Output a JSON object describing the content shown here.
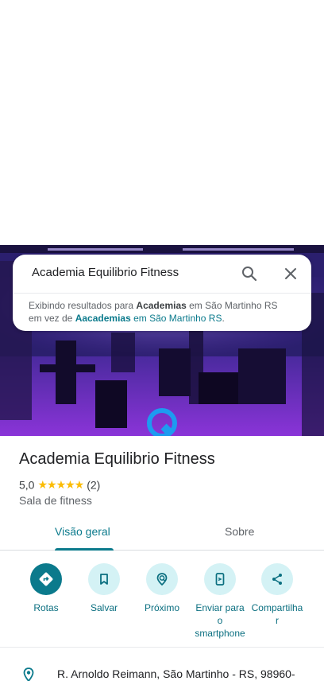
{
  "search": {
    "query": "Academia Equilibrio Fitness",
    "suggestion_prefix": "Exibindo resultados para ",
    "suggestion_term": "Academias",
    "suggestion_mid": " em São Martinho RS",
    "suggestion_alt_prefix": "em vez de ",
    "suggestion_alt_term": "Aacademias",
    "suggestion_alt_location": " em São Martinho RS",
    "suggestion_end": "."
  },
  "place": {
    "title": "Academia Equilibrio Fitness",
    "rating": "5,0",
    "stars": "★★★★★",
    "review_count": "(2)",
    "category": "Sala de fitness"
  },
  "tabs": [
    {
      "label": "Visão geral",
      "active": true
    },
    {
      "label": "Sobre",
      "active": false
    }
  ],
  "actions": [
    {
      "label": "Rotas",
      "icon": "directions-icon"
    },
    {
      "label": "Salvar",
      "icon": "bookmark-icon"
    },
    {
      "label": "Próximo",
      "icon": "nearby-icon"
    },
    {
      "label_lines": [
        "Enviar para",
        "o",
        "smartphone"
      ],
      "icon": "send-to-phone-icon"
    },
    {
      "label_lines": [
        "Compartilha",
        "r"
      ],
      "icon": "share-icon"
    }
  ],
  "address": {
    "text": "R. Arnoldo Reimann, São Martinho - RS, 98960-",
    "icon": "location-pin-icon"
  },
  "colors": {
    "accent": "#0b7a8c",
    "action_bg": "#d4f2f5",
    "star": "#fbbc04"
  }
}
